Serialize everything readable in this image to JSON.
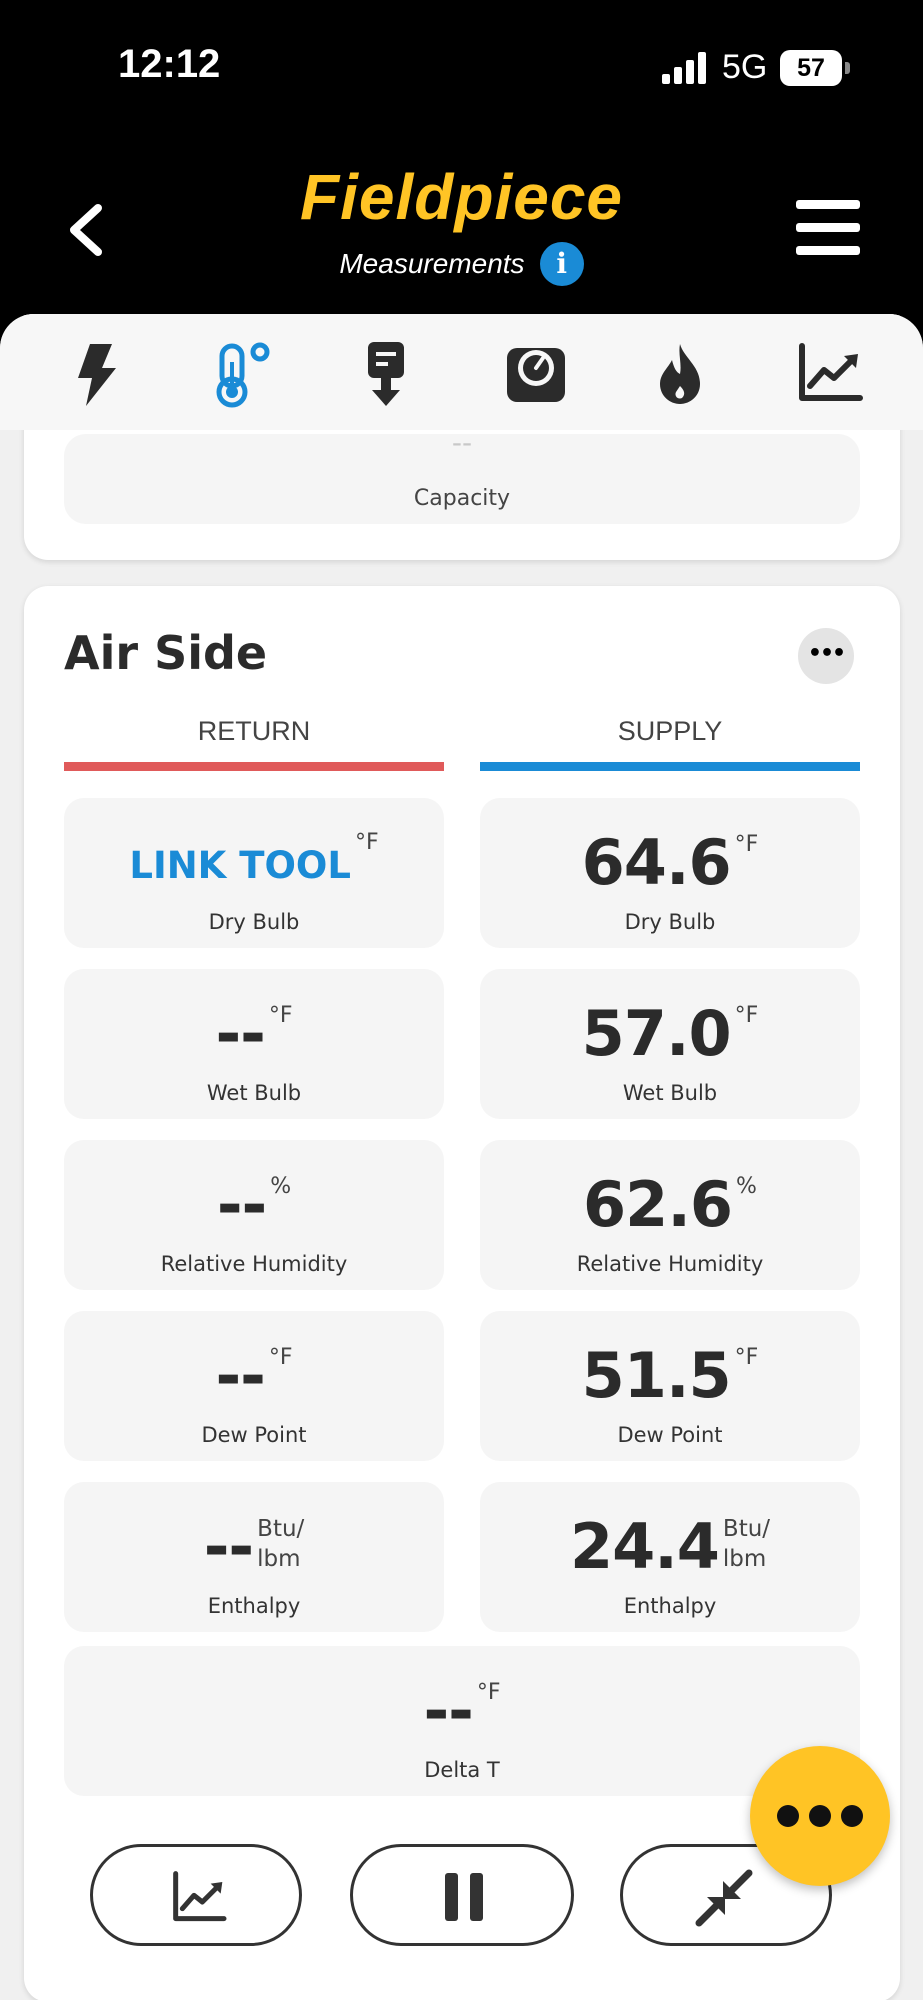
{
  "status": {
    "time": "12:12",
    "network": "5G",
    "battery": "57"
  },
  "header": {
    "brand": "Fieldpiece",
    "subtitle": "Measurements",
    "info_icon": "info-icon"
  },
  "tabs": [
    {
      "name": "electrical",
      "icon": "lightning-bolt-icon",
      "active": false
    },
    {
      "name": "temperature",
      "icon": "thermometer-icon",
      "active": true
    },
    {
      "name": "vacuum",
      "icon": "vacuum-pump-icon",
      "active": false
    },
    {
      "name": "pressure",
      "icon": "gauge-icon",
      "active": false
    },
    {
      "name": "combustion",
      "icon": "flame-icon",
      "active": false
    },
    {
      "name": "charts",
      "icon": "chart-icon",
      "active": false
    }
  ],
  "capacity": {
    "value": "--",
    "label": "Capacity"
  },
  "air_side": {
    "title": "Air Side",
    "return_label": "RETURN",
    "supply_label": "SUPPLY",
    "return_color": "#e05a5a",
    "supply_color": "#1a8bd6",
    "return": {
      "dry_bulb": {
        "value": "LINK TOOL",
        "unit": "°F",
        "label": "Dry Bulb"
      },
      "wet_bulb": {
        "value": "--",
        "unit": "°F",
        "label": "Wet Bulb"
      },
      "rh": {
        "value": "--",
        "unit": "%",
        "label": "Relative Humidity"
      },
      "dew_point": {
        "value": "--",
        "unit": "°F",
        "label": "Dew Point"
      },
      "enthalpy": {
        "value": "--",
        "unit_top": "Btu/",
        "unit_bottom": "lbm",
        "label": "Enthalpy"
      }
    },
    "supply": {
      "dry_bulb": {
        "value": "64.6",
        "unit": "°F",
        "label": "Dry Bulb"
      },
      "wet_bulb": {
        "value": "57.0",
        "unit": "°F",
        "label": "Wet Bulb"
      },
      "rh": {
        "value": "62.6",
        "unit": "%",
        "label": "Relative Humidity"
      },
      "dew_point": {
        "value": "51.5",
        "unit": "°F",
        "label": "Dew Point"
      },
      "enthalpy": {
        "value": "24.4",
        "unit_top": "Btu/",
        "unit_bottom": "lbm",
        "label": "Enthalpy"
      }
    },
    "delta_t": {
      "value": "--",
      "unit": "°F",
      "label": "Delta T"
    }
  },
  "controls": {
    "graph": "chart-icon",
    "pause": "pause-icon",
    "collapse": "collapse-arrows-icon"
  },
  "accent_color": "#ffc425"
}
